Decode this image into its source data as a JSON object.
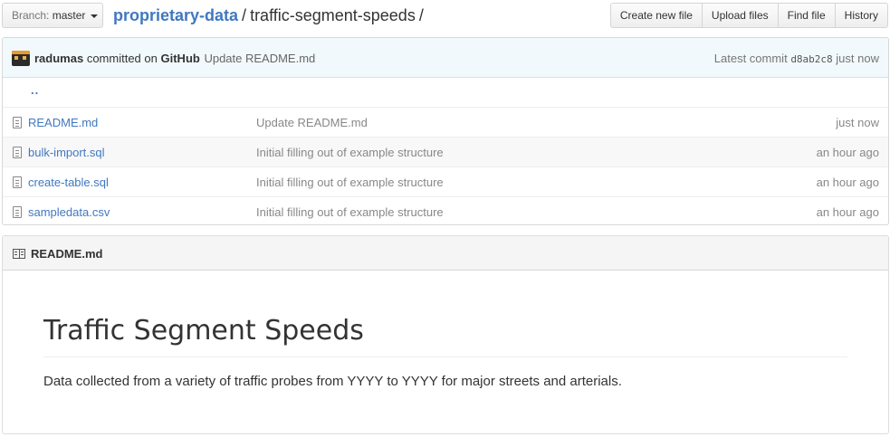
{
  "header": {
    "branch_prefix": "Branch:",
    "branch_name": "master",
    "repo_name": "proprietary-data",
    "path_sep": "/",
    "folder_name": "traffic-segment-speeds",
    "trailing_sep": "/"
  },
  "actions": [
    "Create new file",
    "Upload files",
    "Find file",
    "History"
  ],
  "commit": {
    "author": "radumas",
    "via": "committed on",
    "platform": "GitHub",
    "message": "Update README.md",
    "latest_label": "Latest commit",
    "sha": "d8ab2c8",
    "age": "just now"
  },
  "parent_dir": "..",
  "files": [
    {
      "name": "README.md",
      "message": "Update README.md",
      "age": "just now"
    },
    {
      "name": "bulk-import.sql",
      "message": "Initial filling out of example structure",
      "age": "an hour ago"
    },
    {
      "name": "create-table.sql",
      "message": "Initial filling out of example structure",
      "age": "an hour ago"
    },
    {
      "name": "sampledata.csv",
      "message": "Initial filling out of example structure",
      "age": "an hour ago"
    }
  ],
  "readme": {
    "filename": "README.md",
    "heading": "Traffic Segment Speeds",
    "body": "Data collected from a variety of traffic probes from YYYY to YYYY for major streets and arterials."
  }
}
